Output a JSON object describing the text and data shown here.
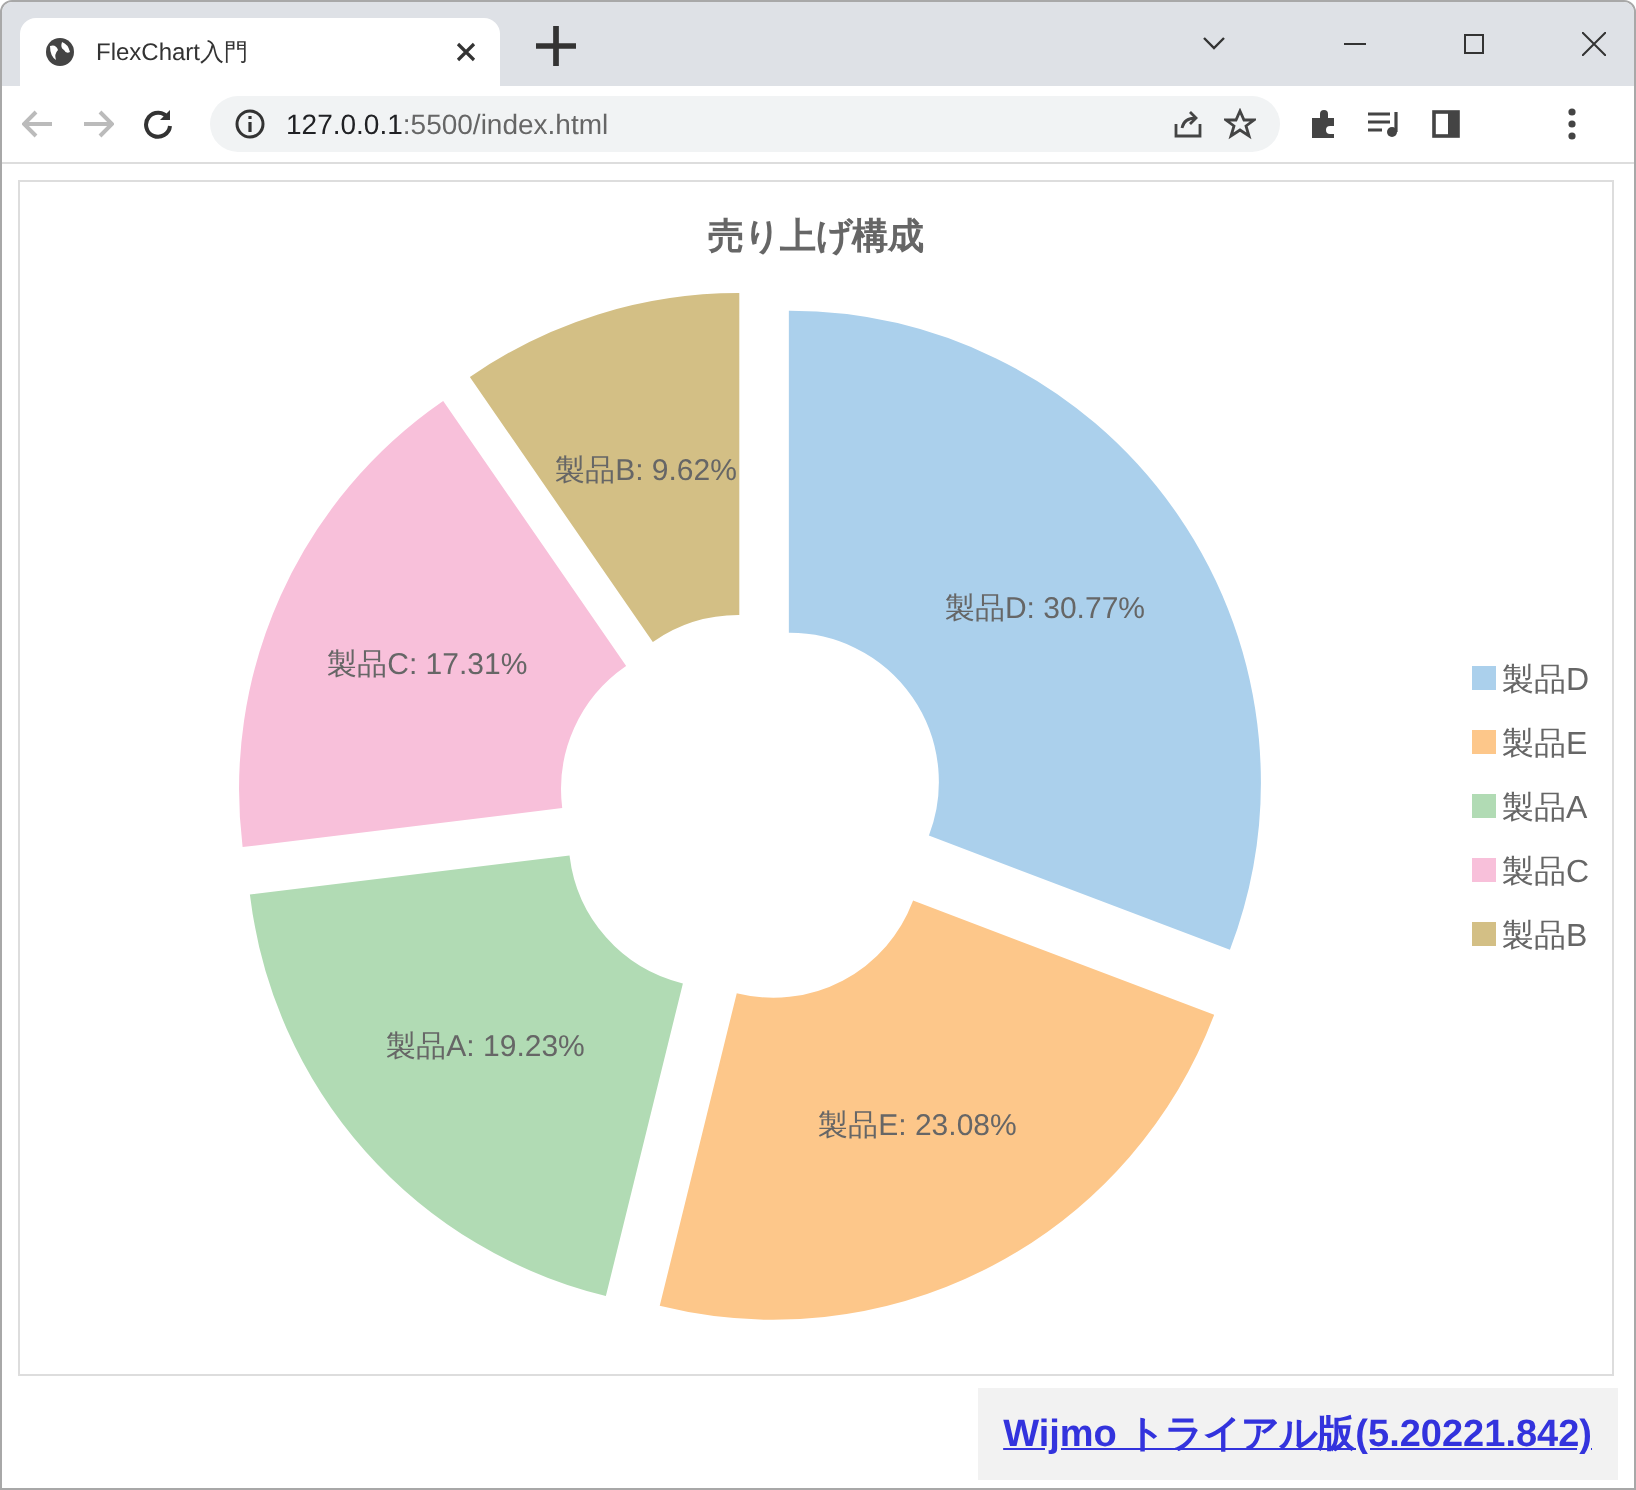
{
  "browser": {
    "tab": {
      "title": "FlexChart入門"
    },
    "address": {
      "host": "127.0.0.1",
      "path": ":5500/index.html"
    }
  },
  "chart": {
    "title": "売り上げ構成",
    "chart_data": {
      "type": "donut",
      "legend": "right",
      "colors": [
        "#abd0ec",
        "#fdc78a",
        "#b1dbb4",
        "#f8c0da",
        "#d3bf85"
      ],
      "categories": [
        "製品D",
        "製品E",
        "製品A",
        "製品C",
        "製品B"
      ],
      "values": [
        30.77,
        23.08,
        19.23,
        17.31,
        9.62
      ],
      "value_labels": [
        "製品D: 30.77%",
        "製品E: 23.08%",
        "製品A: 19.23%",
        "製品C: 17.31%",
        "製品B: 9.62%"
      ]
    }
  },
  "footer_link": "Wijmo トライアル版(5.20221.842)"
}
